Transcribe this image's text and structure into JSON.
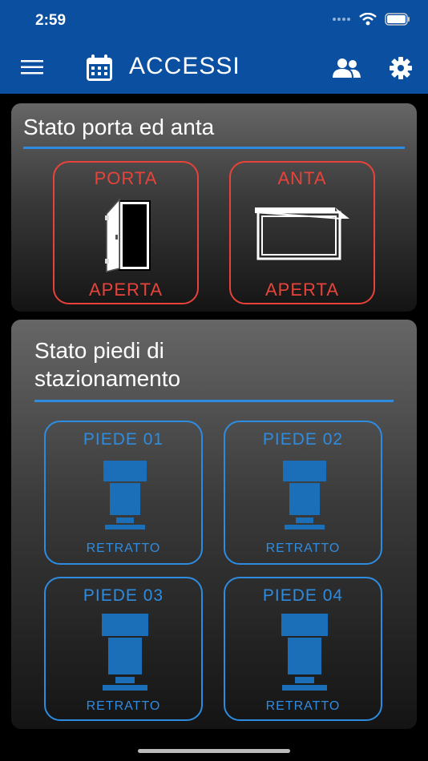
{
  "status_bar": {
    "time": "2:59"
  },
  "nav": {
    "title": "ACCESSI"
  },
  "door_panel": {
    "title": "Stato porta ed anta",
    "tiles": [
      {
        "label": "PORTA",
        "state": "APERTA"
      },
      {
        "label": "ANTA",
        "state": "APERTA"
      }
    ]
  },
  "feet_panel": {
    "title_line1": "Stato piedi di",
    "title_line2": "stazionamento",
    "tiles": [
      {
        "label": "PIEDE 01",
        "state": "RETRATTO"
      },
      {
        "label": "PIEDE 02",
        "state": "RETRATTO"
      },
      {
        "label": "PIEDE 03",
        "state": "RETRATTO"
      },
      {
        "label": "PIEDE 04",
        "state": "RETRATTO"
      }
    ]
  },
  "colors": {
    "header": "#0a4fa0",
    "accent_blue": "#2e8ce0",
    "alert_red": "#e8433a",
    "foot_blue": "#1a6fb8"
  },
  "icons": [
    "menu-icon",
    "calendar-icon",
    "users-icon",
    "gear-icon",
    "door-icon",
    "hatch-icon",
    "stabilizer-foot-icon"
  ]
}
